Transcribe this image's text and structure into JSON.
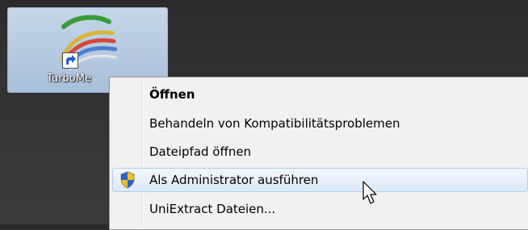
{
  "desktop": {
    "shortcut": {
      "label": "TurboMe",
      "icon": "turbomeeting-app-icon",
      "overlay_icon": "shortcut-arrow-icon"
    }
  },
  "context_menu": {
    "items": [
      {
        "label": "Öffnen",
        "bold": true
      },
      {
        "label": "Behandeln von Kompatibilitätsproblemen"
      },
      {
        "label": "Dateipfad öffnen"
      },
      {
        "label": "Als Administrator ausführen",
        "icon": "uac-shield-icon",
        "highlighted": true
      },
      {
        "label": "UniExtract Dateien..."
      }
    ]
  },
  "cursor": {
    "icon": "mouse-pointer-icon"
  },
  "colors": {
    "desktop_bg": "#333333",
    "selection_fill": "#aec2da",
    "menu_bg": "#f1f1f1",
    "menu_highlight_border": "#aeccf0",
    "shield_blue": "#2a63c9",
    "shield_yellow": "#f2c21b"
  }
}
